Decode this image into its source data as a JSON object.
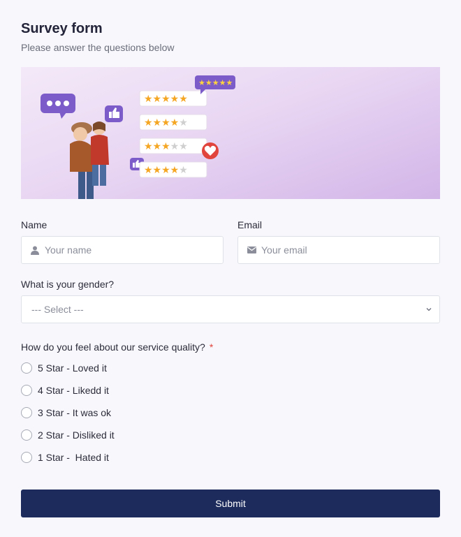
{
  "form": {
    "title": "Survey form",
    "subtitle": "Please answer the questions below"
  },
  "fields": {
    "name": {
      "label": "Name",
      "placeholder": "Your name",
      "icon": "user-icon"
    },
    "email": {
      "label": "Email",
      "placeholder": "Your email",
      "icon": "envelope-icon"
    },
    "gender": {
      "label": "What is your gender?",
      "selected": "--- Select ---"
    }
  },
  "question": {
    "label": "How do you feel about our service quality?",
    "required_mark": "*",
    "options": [
      "5 Star - Loved it",
      "4 Star - Likedd it",
      "3 Star - It was ok",
      "2 Star - Disliked it",
      "1 Star -  Hated it"
    ]
  },
  "submit_label": "Submit",
  "banner": {
    "rating_rows": [
      5,
      4,
      3,
      4
    ],
    "bubble_rating": 5,
    "icons": [
      "chat-bubble-icon",
      "thumbs-up-icon",
      "heart-icon",
      "thumbs-up-icon"
    ]
  },
  "colors": {
    "accent": "#1c2b5c",
    "required": "#e0443c",
    "star": "#f5a623",
    "bubble": "#7b5cc9"
  }
}
